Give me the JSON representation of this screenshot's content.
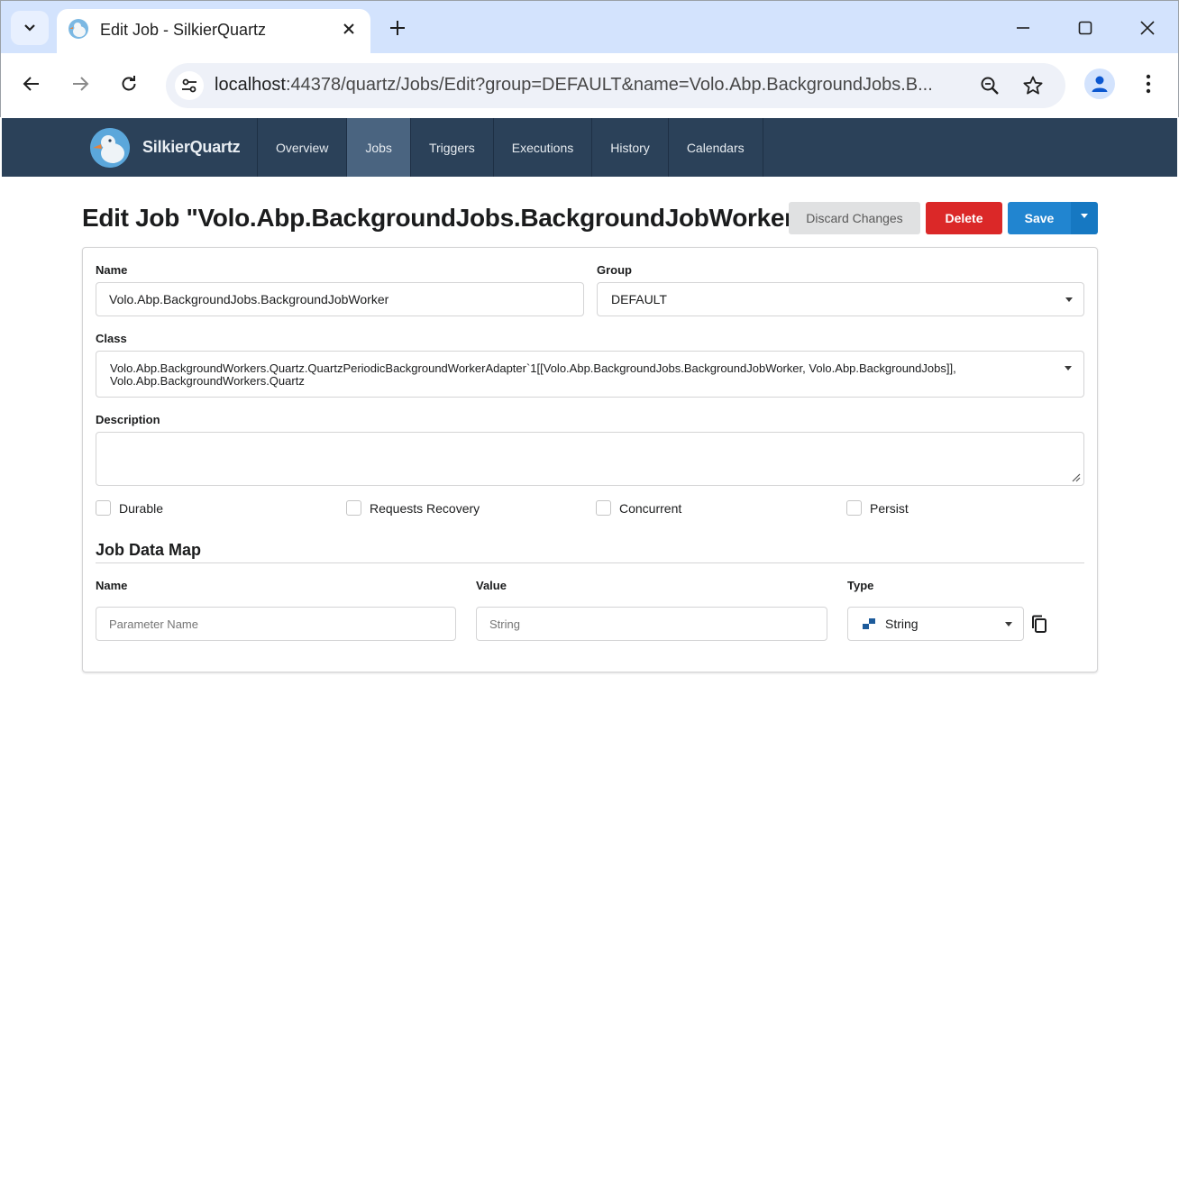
{
  "browser": {
    "tab_title": "Edit Job - SilkierQuartz",
    "url_host": "localhost",
    "url_rest": ":44378/quartz/Jobs/Edit?group=DEFAULT&name=Volo.Abp.BackgroundJobs.B..."
  },
  "app": {
    "brand": "SilkierQuartz",
    "nav": [
      "Overview",
      "Jobs",
      "Triggers",
      "Executions",
      "History",
      "Calendars"
    ],
    "active_nav": "Jobs"
  },
  "page": {
    "title": "Edit Job \"Volo.Abp.BackgroundJobs.BackgroundJobWorker\"",
    "buttons": {
      "discard": "Discard Changes",
      "delete": "Delete",
      "save": "Save"
    }
  },
  "form": {
    "name_label": "Name",
    "name_value": "Volo.Abp.BackgroundJobs.BackgroundJobWorker",
    "group_label": "Group",
    "group_value": "DEFAULT",
    "class_label": "Class",
    "class_value_line1": "Volo.Abp.BackgroundWorkers.Quartz.QuartzPeriodicBackgroundWorkerAdapter`1[[Volo.Abp.BackgroundJobs.BackgroundJobWorker, Volo.Abp.BackgroundJobs]],",
    "class_value_line2": "Volo.Abp.BackgroundWorkers.Quartz",
    "description_label": "Description",
    "description_value": "",
    "checkboxes": [
      {
        "label": "Durable",
        "checked": false
      },
      {
        "label": "Requests Recovery",
        "checked": false
      },
      {
        "label": "Concurrent",
        "checked": false
      },
      {
        "label": "Persist",
        "checked": false
      }
    ]
  },
  "job_data_map": {
    "title": "Job Data Map",
    "col_name": "Name",
    "col_value": "Value",
    "col_type": "Type",
    "name_placeholder": "Parameter Name",
    "value_placeholder": "String",
    "type_value": "String"
  },
  "icons": {
    "tab_search": "chevron-down-icon",
    "close": "close-icon",
    "new_tab": "plus-icon",
    "back": "arrow-left-icon",
    "forward": "arrow-right-icon",
    "reload": "reload-icon",
    "site_info": "tune-icon",
    "zoom": "zoom-icon",
    "bookmark": "star-icon",
    "profile": "person-icon",
    "menu": "more-vert-icon",
    "copy": "copy-icon"
  },
  "colors": {
    "navbar": "#2b4159",
    "primary": "#2185d0",
    "danger": "#db2828",
    "chrome": "#d3e3fd"
  }
}
